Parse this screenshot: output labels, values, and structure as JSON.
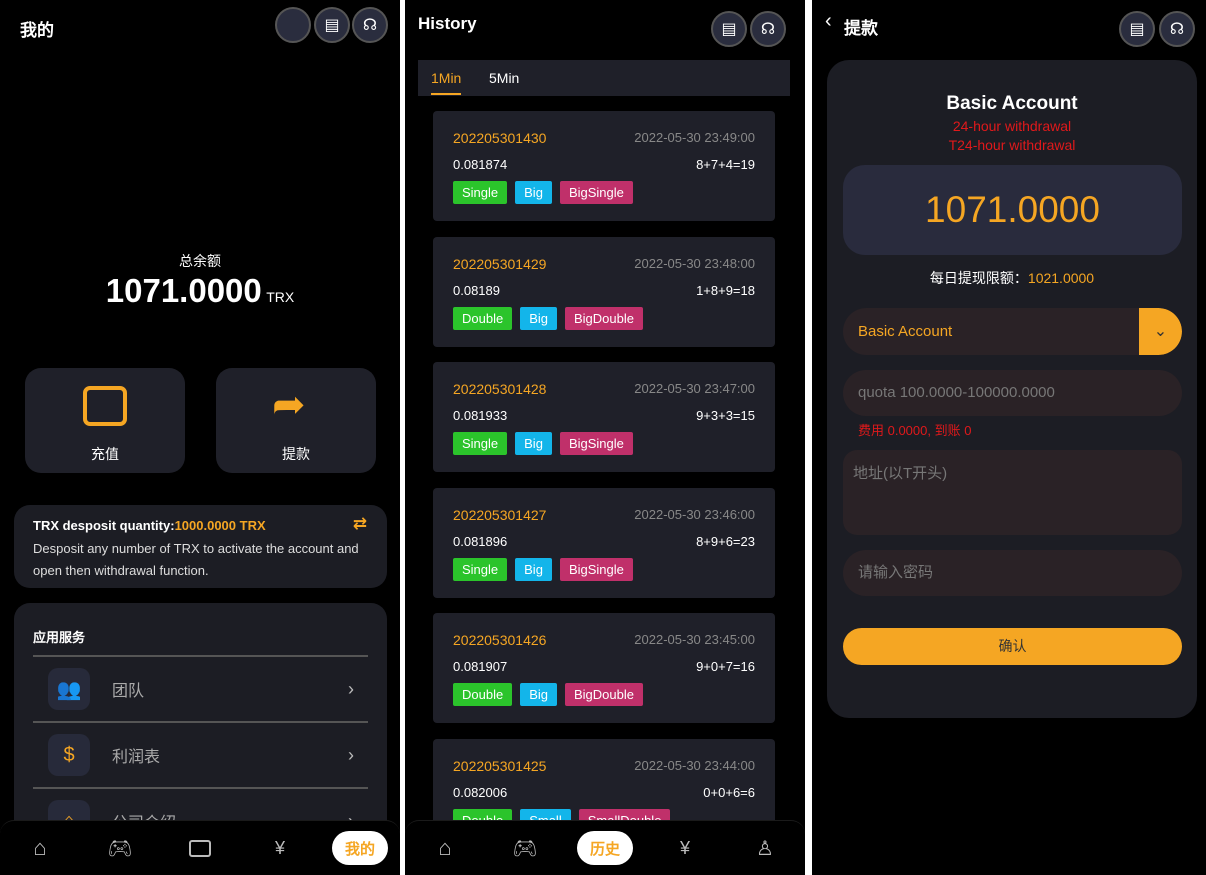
{
  "profile": {
    "title": "我的",
    "balance_label": "总余额",
    "balance": "1071.0000",
    "unit": "TRX",
    "actions": [
      {
        "label": "充值",
        "icon": "wallet-icon"
      },
      {
        "label": "提款",
        "icon": "share-arrow-icon"
      }
    ],
    "notice": {
      "title": "TRX desposit quantity:",
      "amount": "1000.0000 TRX",
      "text": "Desposit any number of TRX to activate the account and open then withdrawal function."
    },
    "services": {
      "title": "应用服务",
      "items": [
        {
          "label": "团队",
          "icon": "team-icon"
        },
        {
          "label": "利润表",
          "icon": "coins-icon"
        },
        {
          "label": "公司介绍",
          "icon": "home-icon"
        }
      ]
    },
    "nav": [
      {
        "icon": "home-icon"
      },
      {
        "icon": "gamepad-icon"
      },
      {
        "icon": "wallet-icon"
      },
      {
        "icon": "money-bag-icon"
      },
      {
        "label": "我的",
        "active": true
      }
    ]
  },
  "history": {
    "title": "History",
    "tabs": [
      "1Min",
      "5Min"
    ],
    "active_tab": "1Min",
    "records": [
      {
        "id": "202205301430",
        "time": "2022-05-30 23:49:00",
        "value": "0.081874",
        "sum": "8+7+4=19",
        "tags": [
          "Single",
          "Big",
          "BigSingle"
        ]
      },
      {
        "id": "202205301429",
        "time": "2022-05-30 23:48:00",
        "value": "0.08189",
        "sum": "1+8+9=18",
        "tags": [
          "Double",
          "Big",
          "BigDouble"
        ]
      },
      {
        "id": "202205301428",
        "time": "2022-05-30 23:47:00",
        "value": "0.081933",
        "sum": "9+3+3=15",
        "tags": [
          "Single",
          "Big",
          "BigSingle"
        ]
      },
      {
        "id": "202205301427",
        "time": "2022-05-30 23:46:00",
        "value": "0.081896",
        "sum": "8+9+6=23",
        "tags": [
          "Single",
          "Big",
          "BigSingle"
        ]
      },
      {
        "id": "202205301426",
        "time": "2022-05-30 23:45:00",
        "value": "0.081907",
        "sum": "9+0+7=16",
        "tags": [
          "Double",
          "Big",
          "BigDouble"
        ]
      },
      {
        "id": "202205301425",
        "time": "2022-05-30 23:44:00",
        "value": "0.082006",
        "sum": "0+0+6=6",
        "tags": [
          "Double",
          "Small",
          "SmallDouble"
        ]
      }
    ],
    "nav": [
      {
        "icon": "home-icon"
      },
      {
        "icon": "gamepad-icon"
      },
      {
        "label": "历史",
        "active": true
      },
      {
        "icon": "money-bag-icon"
      },
      {
        "icon": "user-icon"
      }
    ]
  },
  "withdraw": {
    "title": "提款",
    "account_title": "Basic Account",
    "line1": "24-hour withdrawal",
    "line2": "T24-hour withdrawal",
    "amount": "1071.0000",
    "limit_label": "每日提现限额：",
    "limit": "1021.0000",
    "account_select": "Basic Account",
    "quota_placeholder": "quota 100.0000-100000.0000",
    "fee_text": "费用 0.0000, 到账 0",
    "address_placeholder": "地址(以T开头)",
    "password_placeholder": "请输入密码",
    "confirm": "确认"
  },
  "colors": {
    "accent": "#f5a623",
    "green": "#2bc42b",
    "blue": "#13b5ea",
    "pink": "#c0306a",
    "red": "#e0191b"
  }
}
